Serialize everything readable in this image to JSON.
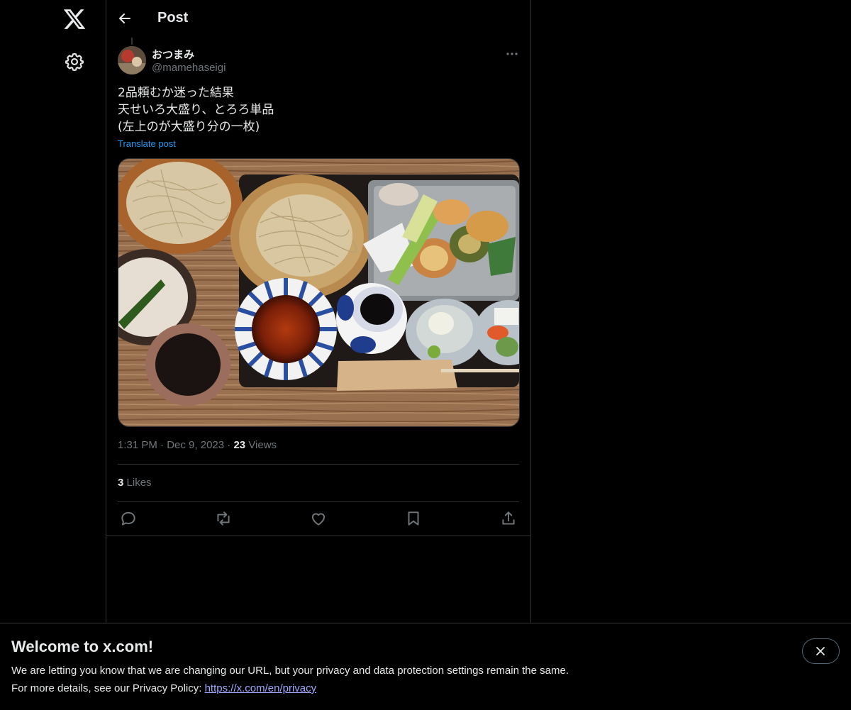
{
  "header": {
    "title": "Post"
  },
  "post": {
    "author_name": "おつまみ",
    "author_handle": "@mamehaseigi",
    "text_lines": [
      "2品頼むか迷った結果",
      "天せいろ大盛り、とろろ単品",
      "(左上のが大盛り分の一枚)"
    ],
    "translate_label": "Translate post",
    "time": "1:31 PM",
    "date": "Dec 9, 2023",
    "views_count": "23",
    "views_label": "Views",
    "likes_count": "3",
    "likes_label": "Likes"
  },
  "banner": {
    "title": "Welcome to x.com!",
    "line1": "We are letting you know that we are changing our URL, but your privacy and data protection settings remain the same.",
    "line2_prefix": "For more details, see our Privacy Policy: ",
    "link_text": "https://x.com/en/privacy"
  },
  "colors": {
    "background": "#000000",
    "text_primary": "#e7e9ea",
    "text_secondary": "#71767b",
    "accent": "#1d9bf0",
    "border": "#2f3336"
  }
}
